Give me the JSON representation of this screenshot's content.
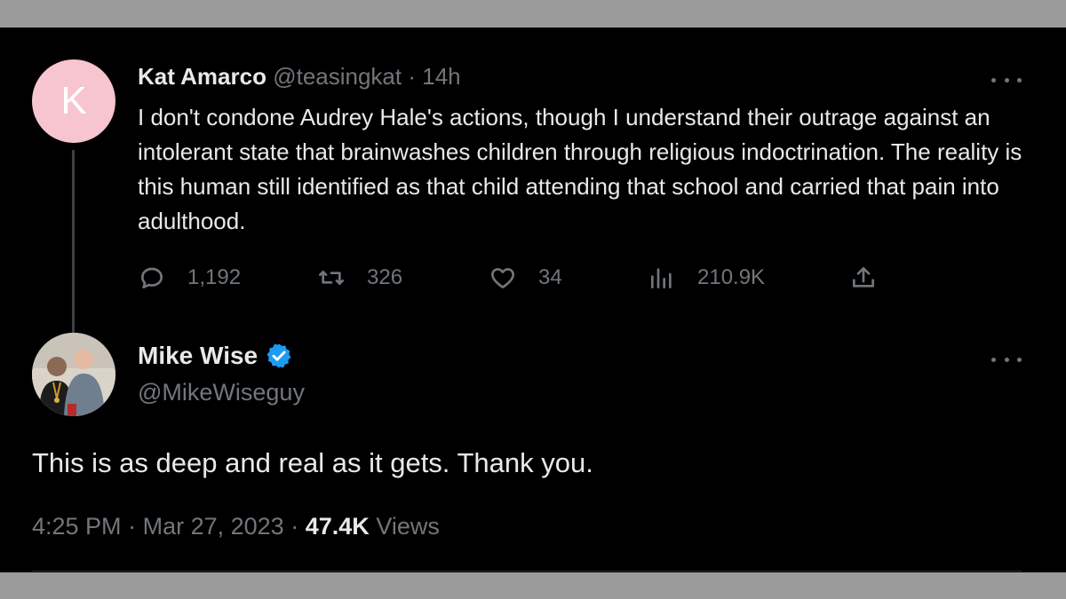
{
  "reply": {
    "avatar_letter": "K",
    "display_name": "Kat Amarco",
    "handle": "@teasingkat",
    "separator": "·",
    "time": "14h",
    "text": "I don't condone Audrey Hale's actions, though I understand their outrage against an intolerant state that brainwashes children through religious indoctrination. The reality is this human still identified as that child attending that school and carried that pain into adulthood.",
    "replies": "1,192",
    "retweets": "326",
    "likes": "34",
    "views": "210.9K"
  },
  "tweet": {
    "display_name": "Mike Wise",
    "handle": "@MikeWiseguy",
    "text": "This is as deep and real as it gets. Thank you.",
    "time": "4:25 PM",
    "sep1": "·",
    "date": "Mar 27, 2023",
    "sep2": "·",
    "views_count": "47.4K",
    "views_label": "Views"
  },
  "colors": {
    "background": "#000000",
    "text": "#e7e9ea",
    "muted": "#71767b",
    "verified": "#1d9bf0",
    "avatar_k": "#f7c5cf"
  },
  "icons": [
    "reply-icon",
    "retweet-icon",
    "like-icon",
    "views-icon",
    "share-icon",
    "more-icon",
    "verified-badge-icon"
  ]
}
